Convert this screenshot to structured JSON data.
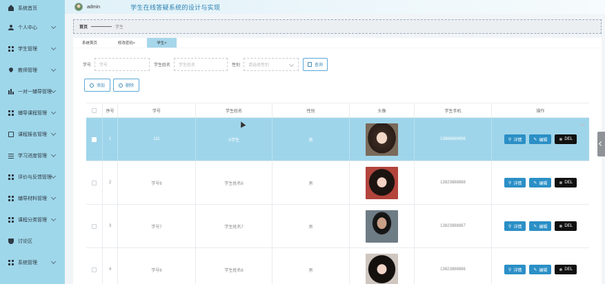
{
  "header": {
    "username": "admin",
    "app_title": "学生在线答疑系统的设计与实现"
  },
  "sidebar": {
    "items": [
      {
        "label": "系统首页",
        "icon": "home-icon",
        "has_arrow": false
      },
      {
        "label": "个人中心",
        "icon": "user-icon",
        "has_arrow": true
      },
      {
        "label": "学生管理",
        "icon": "grid-icon",
        "has_arrow": true
      },
      {
        "label": "教师管理",
        "icon": "pin-icon",
        "has_arrow": true
      },
      {
        "label": "一对一辅导管理",
        "icon": "chart-icon",
        "has_arrow": true
      },
      {
        "label": "辅导课程管理",
        "icon": "grid-icon",
        "has_arrow": true
      },
      {
        "label": "课程报名管理",
        "icon": "clipboard-icon",
        "has_arrow": true
      },
      {
        "label": "学习进度管理",
        "icon": "sliders-icon",
        "has_arrow": true
      },
      {
        "label": "评价与反馈管理",
        "icon": "grid-icon",
        "has_arrow": true
      },
      {
        "label": "辅导材料管理",
        "icon": "grid-icon",
        "has_arrow": true
      },
      {
        "label": "课程分类管理",
        "icon": "grid-icon",
        "has_arrow": true
      },
      {
        "label": "讨论区",
        "icon": "shield-icon",
        "has_arrow": false
      },
      {
        "label": "系统管理",
        "icon": "grid-icon",
        "has_arrow": true
      }
    ]
  },
  "breadcrumb": {
    "home": "首页",
    "current": "学生"
  },
  "tabs": [
    {
      "label": "系统首页",
      "active": false
    },
    {
      "label": "修改密码×",
      "active": false
    },
    {
      "label": "学生×",
      "active": true
    }
  ],
  "search": {
    "student_no_label": "学号",
    "student_no_placeholder": "学号",
    "name_label": "学生姓名",
    "name_placeholder": "学生姓名",
    "gender_label": "性别",
    "gender_placeholder": "请选择性别",
    "query_label": "查询"
  },
  "actions": {
    "add_label": "添加",
    "delete_label": "删除"
  },
  "table": {
    "columns": [
      "序号",
      "学号",
      "学生姓名",
      "性别",
      "头像",
      "学生手机",
      "操作"
    ],
    "rows": [
      {
        "index": "1",
        "student_no": "111",
        "name": "A学生",
        "gender": "男",
        "phone": "13866669696",
        "selected": true,
        "photo": "photo-girl-1"
      },
      {
        "index": "2",
        "student_no": "学号8",
        "name": "学生姓名8",
        "gender": "男",
        "phone": "13823888888",
        "selected": false,
        "photo": "photo-girl-2"
      },
      {
        "index": "3",
        "student_no": "学号7",
        "name": "学生姓名7",
        "gender": "男",
        "phone": "13823888887",
        "selected": false,
        "photo": "photo-boy-1"
      },
      {
        "index": "4",
        "student_no": "学号6",
        "name": "学生姓名6",
        "gender": "男",
        "phone": "13823888886",
        "selected": false,
        "photo": "photo-girl-3"
      }
    ],
    "op_detail": "详情",
    "op_edit": "编辑",
    "op_del": "DEL"
  },
  "colors": {
    "sidebar_bg": "#9fd7ea",
    "selected_row": "#9fd5ea",
    "primary": "#2b8fc6",
    "danger": "#111111"
  }
}
